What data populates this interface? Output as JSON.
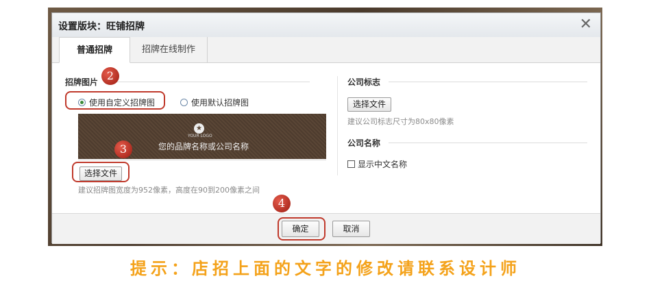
{
  "dialog": {
    "title": "设置版块：旺铺招牌",
    "close_glyph": "✕"
  },
  "tabs": [
    {
      "label": "普通招牌",
      "active": true
    },
    {
      "label": "招牌在线制作",
      "active": false
    }
  ],
  "left": {
    "section_title": "招牌图片",
    "radio_custom": "使用自定义招牌图",
    "radio_default": "使用默认招牌图",
    "selected_radio": "custom",
    "banner_logo_text": "YOUR LOGO",
    "banner_name": "您的品牌名称或公司名称",
    "choose_file": "选择文件",
    "hint": "建议招牌图宽度为952像素，高度在90到200像素之间"
  },
  "right": {
    "logo_title": "公司标志",
    "choose_file": "选择文件",
    "logo_hint": "建议公司标志尺寸为80x80像素",
    "name_title": "公司名称",
    "show_chinese_name": "显示中文名称",
    "show_chinese_checked": false
  },
  "footer": {
    "confirm": "确定",
    "cancel": "取消"
  },
  "badges": [
    "2",
    "3",
    "4"
  ],
  "note": "提示：店招上面的文字的修改请联系设计师",
  "colors": {
    "accent_red": "#c0392b",
    "note_orange": "#f4a21a"
  }
}
